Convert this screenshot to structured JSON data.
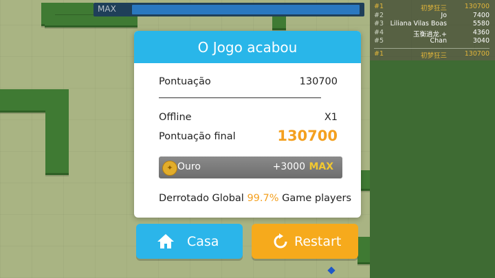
{
  "hud": {
    "max_label": "MAX",
    "progress_fraction": 0.95
  },
  "leaderboard": {
    "entries": [
      {
        "rank": "#1",
        "name": "初梦狂三",
        "score": "130700"
      },
      {
        "rank": "#2",
        "name": "Jo",
        "score": "7400"
      },
      {
        "rank": "#3",
        "name": "Liliana Vilas Boas",
        "score": "5580"
      },
      {
        "rank": "#4",
        "name": "玉衡逍龙.+",
        "score": "4360"
      },
      {
        "rank": "#5",
        "name": "Chan",
        "score": "3040"
      }
    ],
    "self": {
      "rank": "#1",
      "name": "初梦狂三",
      "score": "130700"
    }
  },
  "dialog": {
    "title": "O Jogo acabou",
    "score_label": "Pontuação",
    "score_value": "130700",
    "offline_label": "Offline",
    "offline_value": "X1",
    "final_label": "Pontuação final",
    "final_value": "130700",
    "gold_label": "Ouro",
    "gold_amount": "+3000",
    "gold_max": "MAX",
    "defeated_prefix": "Derrotado Global",
    "defeated_pct": "99.7%",
    "defeated_suffix": "Game players"
  },
  "buttons": {
    "home": "Casa",
    "restart": "Restart"
  },
  "colors": {
    "header": "#29b6e9",
    "home_button": "#2bb5ea",
    "restart_button": "#f6aa1c",
    "highlight": "#f4a01f"
  }
}
